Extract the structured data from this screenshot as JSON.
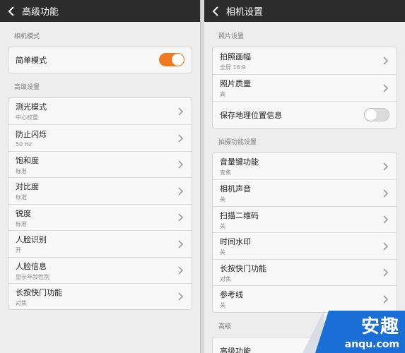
{
  "left": {
    "title": "高级功能",
    "sections": [
      {
        "header": "相机模式",
        "items": [
          {
            "label": "简单模式",
            "toggle": "on"
          }
        ]
      },
      {
        "header": "高级设置",
        "items": [
          {
            "label": "测光模式",
            "sub": "中心权重"
          },
          {
            "label": "防止闪烁",
            "sub": "50 Hz"
          },
          {
            "label": "饱和度",
            "sub": "标准"
          },
          {
            "label": "对比度",
            "sub": "标准"
          },
          {
            "label": "锐度",
            "sub": "标准"
          },
          {
            "label": "人脸识别",
            "sub": "开"
          },
          {
            "label": "人脸信息",
            "sub": "显示年龄性别"
          },
          {
            "label": "长按快门功能",
            "sub": "对焦"
          }
        ]
      }
    ]
  },
  "right": {
    "title": "相机设置",
    "sections": [
      {
        "header": "照片设置",
        "items": [
          {
            "label": "拍照画幅",
            "sub": "全屏 16:9"
          },
          {
            "label": "照片质量",
            "sub": "高"
          },
          {
            "label": "保存地理位置信息",
            "toggle": "off"
          }
        ]
      },
      {
        "header": "拍摄功能设置",
        "items": [
          {
            "label": "音量键功能",
            "sub": "变焦"
          },
          {
            "label": "相机声音",
            "sub": "关"
          },
          {
            "label": "扫描二维码",
            "sub": "关"
          },
          {
            "label": "时间水印",
            "sub": "关"
          },
          {
            "label": "长按快门功能",
            "sub": "对焦"
          },
          {
            "label": "参考线",
            "sub": "关"
          }
        ]
      },
      {
        "header": "高级",
        "items": [
          {
            "label": "高级功能"
          }
        ]
      }
    ]
  },
  "watermark": {
    "big": "安趣",
    "small": "anqu.com"
  },
  "colors": {
    "accent": "#f07a1f",
    "titlebar": "#2c2c2c",
    "background": "#ededed"
  }
}
